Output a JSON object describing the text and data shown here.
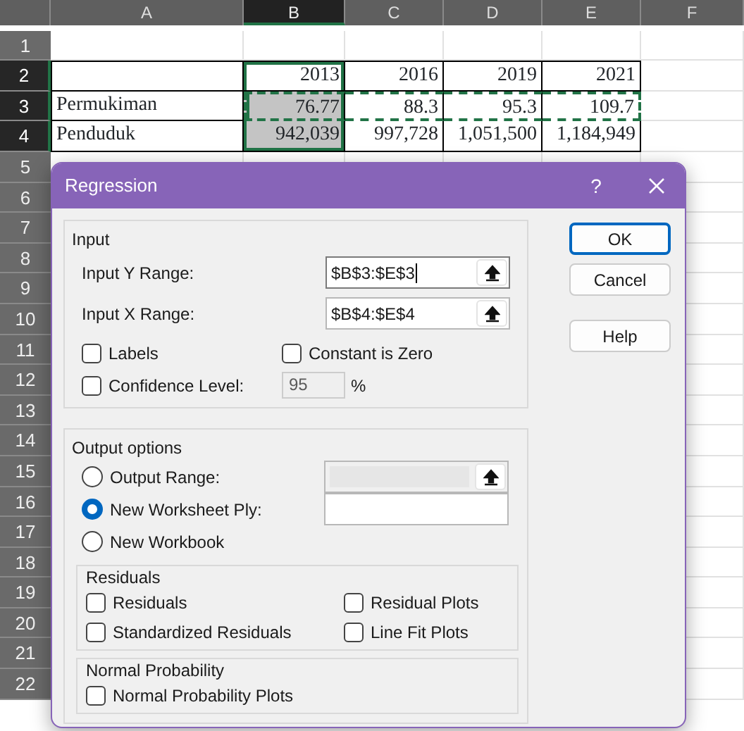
{
  "sheet": {
    "columns": [
      {
        "label": "A",
        "selected": false
      },
      {
        "label": "B",
        "selected": true
      },
      {
        "label": "C",
        "selected": false
      },
      {
        "label": "D",
        "selected": false
      },
      {
        "label": "E",
        "selected": false
      },
      {
        "label": "F",
        "selected": false
      }
    ],
    "rows": [
      {
        "header": "1",
        "selected": false
      },
      {
        "header": "2",
        "selected": true,
        "bordered": true,
        "cells": [
          {},
          {
            "text": "2013",
            "in_selection": true,
            "highlighted": false,
            "marquee": false
          },
          {
            "text": "2016",
            "in_selection": false,
            "highlighted": false,
            "marquee": false
          },
          {
            "text": "2019",
            "in_selection": false,
            "highlighted": false,
            "marquee": false
          },
          {
            "text": "2021",
            "in_selection": false,
            "highlighted": false,
            "marquee": false
          }
        ]
      },
      {
        "header": "3",
        "selected": true,
        "bordered": true,
        "cells": [
          {
            "text": "Permukiman",
            "kind": "label"
          },
          {
            "text": "76.77",
            "in_selection": true,
            "highlighted": true,
            "marquee": true
          },
          {
            "text": "88.3",
            "in_selection": false,
            "highlighted": false,
            "marquee": true
          },
          {
            "text": "95.3",
            "in_selection": false,
            "highlighted": false,
            "marquee": true
          },
          {
            "text": "109.7",
            "in_selection": false,
            "highlighted": false,
            "marquee": true
          }
        ]
      },
      {
        "header": "4",
        "selected": true,
        "bordered": true,
        "cells": [
          {
            "text": "Penduduk",
            "kind": "label"
          },
          {
            "text": "942,039",
            "in_selection": true,
            "highlighted": true,
            "marquee": false
          },
          {
            "text": "997,728",
            "in_selection": false,
            "highlighted": false,
            "marquee": false
          },
          {
            "text": "1,051,500",
            "in_selection": false,
            "highlighted": false,
            "marquee": false
          },
          {
            "text": "1,184,949",
            "in_selection": false,
            "highlighted": false,
            "marquee": false
          }
        ]
      },
      {
        "header": "5",
        "selected": false
      },
      {
        "header": "6",
        "selected": false
      },
      {
        "header": "7",
        "selected": false
      },
      {
        "header": "8",
        "selected": false
      },
      {
        "header": "9",
        "selected": false
      },
      {
        "header": "10",
        "selected": false
      },
      {
        "header": "11",
        "selected": false
      },
      {
        "header": "12",
        "selected": false
      },
      {
        "header": "13",
        "selected": false
      },
      {
        "header": "14",
        "selected": false
      },
      {
        "header": "15",
        "selected": false
      },
      {
        "header": "16",
        "selected": false
      },
      {
        "header": "17",
        "selected": false
      },
      {
        "header": "18",
        "selected": false
      },
      {
        "header": "19",
        "selected": false
      },
      {
        "header": "20",
        "selected": false
      },
      {
        "header": "21",
        "selected": false
      },
      {
        "header": "22",
        "selected": false
      }
    ]
  },
  "dialog": {
    "title": "Regression",
    "help": "?",
    "input": {
      "legend": "Input",
      "ranges": [
        {
          "label": "Input Y Range:",
          "value": "$B$3:$E$3",
          "focused": true
        },
        {
          "label": "Input X Range:",
          "value": "$B$4:$E$4",
          "focused": false
        }
      ],
      "options": [
        {
          "label": "Labels",
          "checked": false
        },
        {
          "label": "Constant is Zero",
          "checked": false
        },
        {
          "label": "Confidence Level:",
          "checked": false
        }
      ],
      "confidence": {
        "value": "95",
        "disabled": true,
        "unit": "%"
      }
    },
    "output": {
      "legend": "Output options",
      "destinations": [
        {
          "label": "Output Range:",
          "selected": false,
          "field": {
            "disabled": true,
            "picker": true
          }
        },
        {
          "label": "New Worksheet Ply:",
          "selected": true,
          "field": {
            "disabled": false,
            "picker": false
          }
        },
        {
          "label": "New Workbook",
          "selected": false
        }
      ],
      "residuals": {
        "legend": "Residuals",
        "options": [
          {
            "label": "Residuals",
            "checked": false
          },
          {
            "label": "Residual Plots",
            "checked": false
          },
          {
            "label": "Standardized Residuals",
            "checked": false
          },
          {
            "label": "Line Fit Plots",
            "checked": false
          }
        ]
      },
      "normal_probability": {
        "legend": "Normal Probability",
        "options": [
          {
            "label": "Normal Probability Plots",
            "checked": false
          }
        ]
      }
    },
    "buttons": [
      {
        "label": "OK",
        "default": true
      },
      {
        "label": "Cancel",
        "default": false
      },
      {
        "label": "Help",
        "default": false
      }
    ]
  }
}
